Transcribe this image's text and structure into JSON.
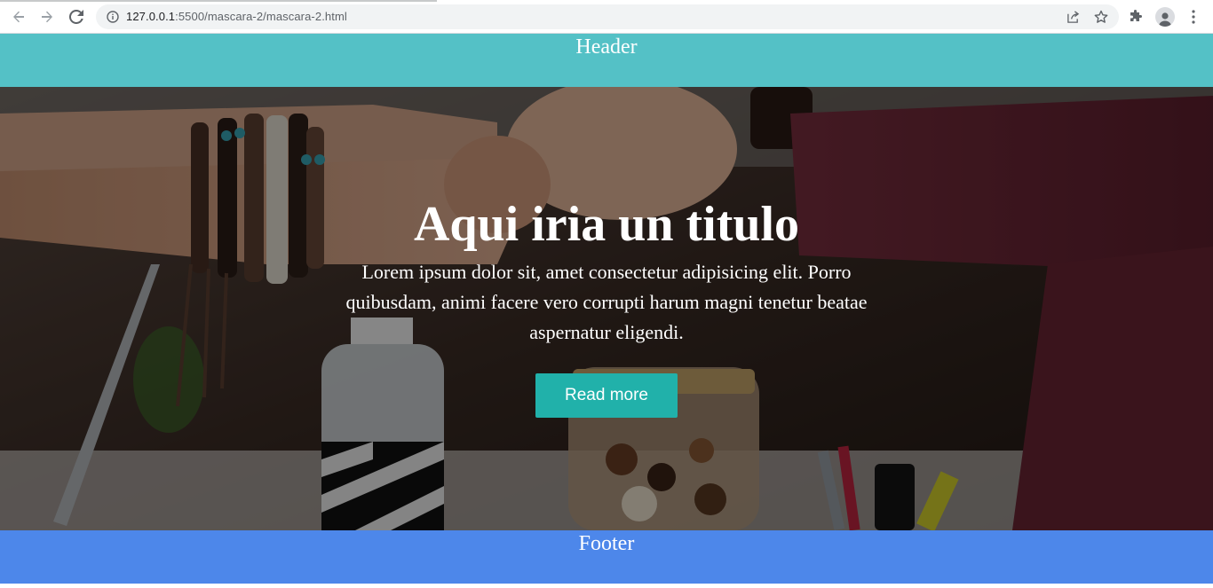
{
  "browser": {
    "url_host": "127.0.0.1",
    "url_path": ":5500/mascara-2/mascara-2.html"
  },
  "page": {
    "header_text": "Header",
    "hero": {
      "title": "Aqui iria un titulo",
      "text": "Lorem ipsum dolor sit, amet consectetur adipisicing elit. Porro quibusdam, animi facere vero corrupti harum magni tenetur beatae aspernatur eligendi.",
      "button_label": "Read more"
    },
    "footer_text": "Footer"
  },
  "colors": {
    "header_bg": "#54c1c6",
    "footer_bg": "#4d87ea",
    "button_bg": "#21b1aa"
  }
}
